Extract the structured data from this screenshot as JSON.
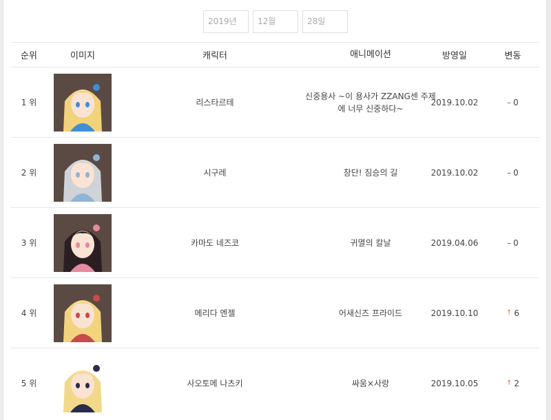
{
  "date": {
    "year": "2019년",
    "month": "12월",
    "day": "28일"
  },
  "headers": {
    "rank": "순위",
    "image": "이미지",
    "character": "캐릭터",
    "animation": "애니메이션",
    "air_date": "방영일",
    "change": "변동"
  },
  "rows": [
    {
      "rank": "1 위",
      "character": "리스타르테",
      "animation": "신중용사 ~이 용사가 ZZANG센 주제에 너무 신중하다~",
      "air_date": "2019.10.02",
      "change_symbol": "–",
      "change_value": "0",
      "trend": "none",
      "hair_color": "#f2d27a",
      "accent_color": "#3f8ed6"
    },
    {
      "rank": "2 위",
      "character": "시구레",
      "animation": "창단! 짐승의 길",
      "air_date": "2019.10.02",
      "change_symbol": "–",
      "change_value": "0",
      "trend": "none",
      "hair_color": "#cfd3d8",
      "accent_color": "#8fb4d6"
    },
    {
      "rank": "3 위",
      "character": "카마도 네즈코",
      "animation": "귀멸의 칼날",
      "air_date": "2019.04.06",
      "change_symbol": "–",
      "change_value": "0",
      "trend": "none",
      "hair_color": "#2a1e22",
      "accent_color": "#e58aa0"
    },
    {
      "rank": "4 위",
      "character": "메리다 엔젤",
      "animation": "어새신즈 프라이드",
      "air_date": "2019.10.10",
      "change_symbol": "↑",
      "change_value": "6",
      "trend": "up",
      "hair_color": "#f3d47e",
      "accent_color": "#c94a4a"
    },
    {
      "rank": "5 위",
      "character": "사오토메 나츠키",
      "animation": "싸움×사랑",
      "air_date": "2019.10.05",
      "change_symbol": "↑",
      "change_value": "2",
      "trend": "up",
      "hair_color": "#f2d889",
      "accent_color": "#2b2b4a"
    }
  ]
}
